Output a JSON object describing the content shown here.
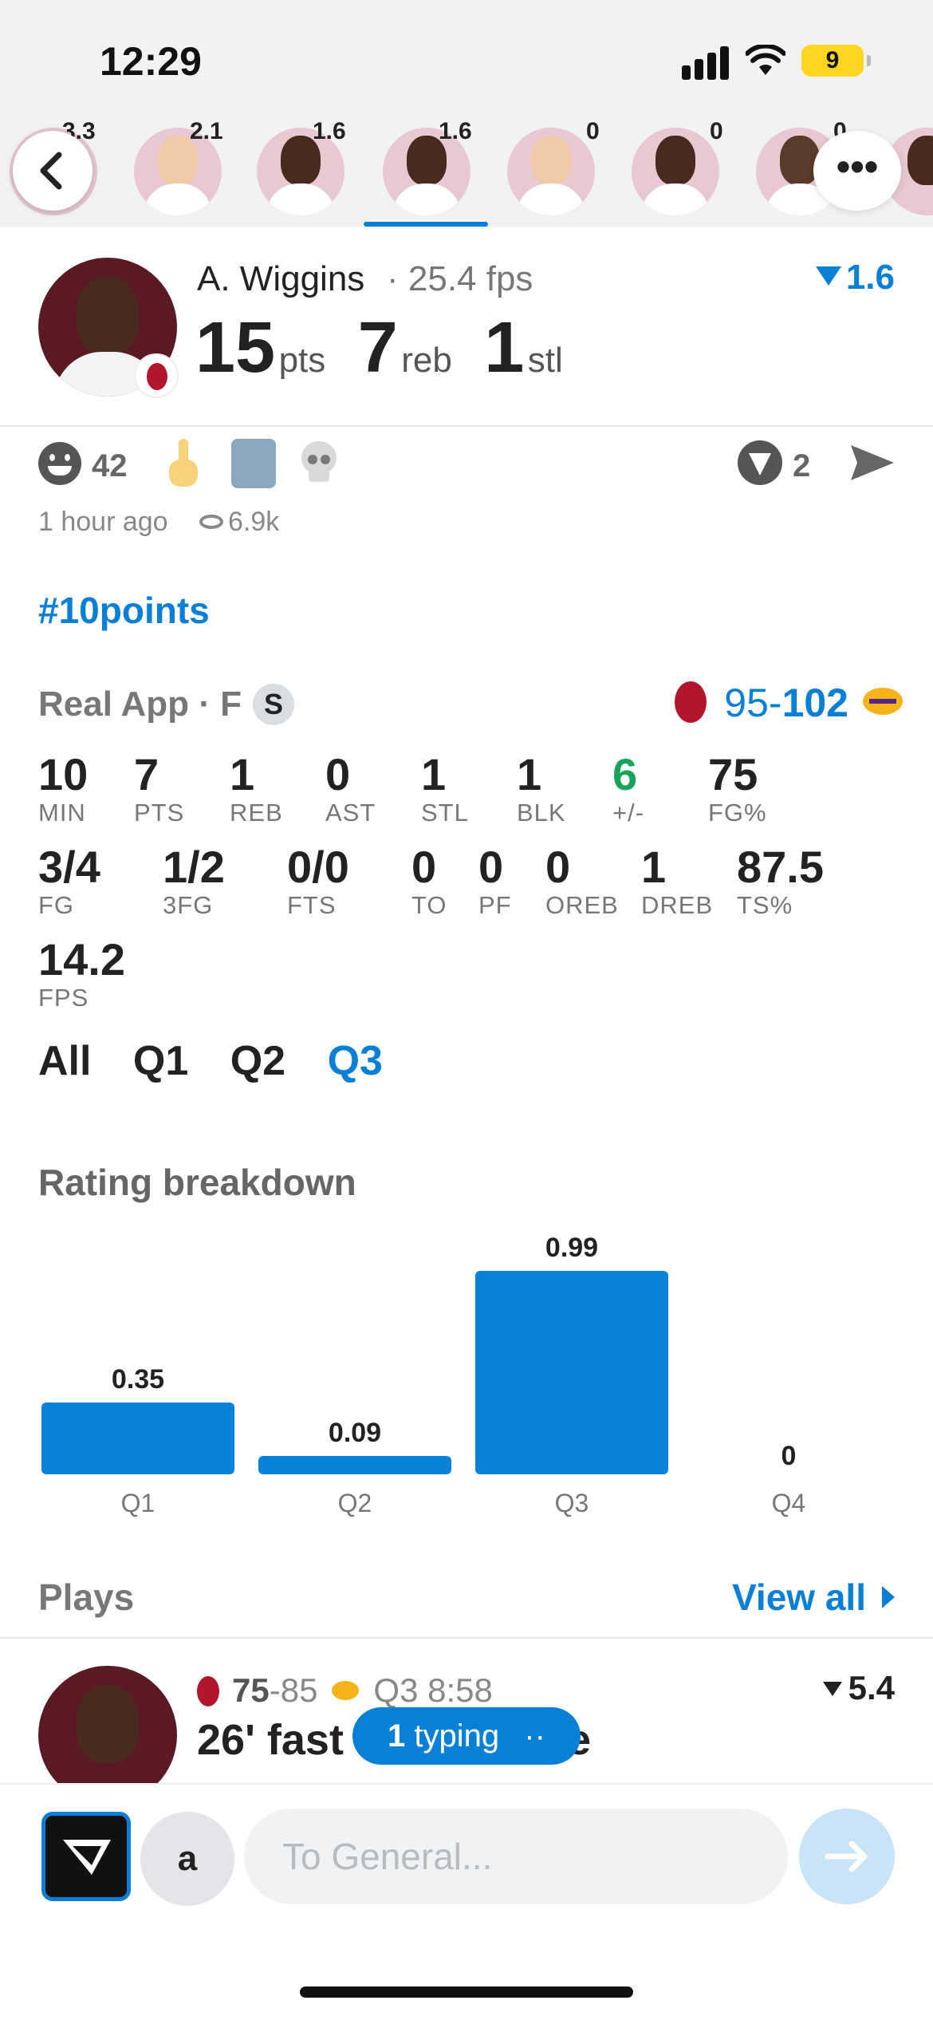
{
  "status_bar": {
    "time": "12:29",
    "battery": "9"
  },
  "carousel": {
    "players": [
      {
        "rating": "3.3",
        "active": false
      },
      {
        "rating": "2.1",
        "active": false
      },
      {
        "rating": "1.6",
        "active": false
      },
      {
        "rating": "1.6",
        "active": true
      },
      {
        "rating": "0",
        "active": false
      },
      {
        "rating": "0",
        "active": false
      },
      {
        "rating": "0",
        "active": false
      }
    ],
    "more_label": "•••"
  },
  "player": {
    "name": "A. Wiggins",
    "fps": "· 25.4 fps",
    "rating": "1.6",
    "stats": [
      {
        "value": "15",
        "label": "pts"
      },
      {
        "value": "7",
        "label": "reb"
      },
      {
        "value": "1",
        "label": "stl"
      }
    ]
  },
  "reactions": {
    "smile_count": "42",
    "boost_count": "2",
    "time_ago": "1 hour ago",
    "views": "6.9k"
  },
  "hashtag": "#10points",
  "game": {
    "source": "Real App · F",
    "badge": "S",
    "score_home": "95",
    "score_sep": "-",
    "score_away": "102",
    "stats_row1": [
      {
        "value": "10",
        "label": "MIN"
      },
      {
        "value": "7",
        "label": "PTS"
      },
      {
        "value": "1",
        "label": "REB"
      },
      {
        "value": "0",
        "label": "AST"
      },
      {
        "value": "1",
        "label": "STL"
      },
      {
        "value": "1",
        "label": "BLK"
      },
      {
        "value": "6",
        "label": "+/-"
      },
      {
        "value": "75",
        "label": "FG%"
      }
    ],
    "stats_row2": [
      {
        "value": "3/4",
        "label": "FG"
      },
      {
        "value": "1/2",
        "label": "3FG"
      },
      {
        "value": "0/0",
        "label": "FTS"
      },
      {
        "value": "0",
        "label": "TO"
      },
      {
        "value": "0",
        "label": "PF"
      },
      {
        "value": "0",
        "label": "OREB"
      },
      {
        "value": "1",
        "label": "DREB"
      },
      {
        "value": "87.5",
        "label": "TS%"
      }
    ],
    "stats_row3": [
      {
        "value": "14.2",
        "label": "FPS"
      }
    ],
    "quarter_tabs": [
      "All",
      "Q1",
      "Q2",
      "Q3"
    ],
    "active_tab": "Q3"
  },
  "rating_breakdown": {
    "title": "Rating breakdown"
  },
  "chart_data": {
    "type": "bar",
    "title": "Rating breakdown",
    "categories": [
      "Q1",
      "Q2",
      "Q3",
      "Q4"
    ],
    "values": [
      0.35,
      0.09,
      0.99,
      0
    ],
    "value_labels": [
      "0.35",
      "0.09",
      "0.99",
      "0"
    ],
    "color": "#0981d8",
    "ylim": [
      0,
      1
    ],
    "grid": false
  },
  "plays": {
    "title": "Plays",
    "view_all": "View all",
    "first_play": {
      "score_home": "75",
      "score_sep": "-85",
      "time": "Q3 8:58",
      "rating": "5.4",
      "description": "26' fast",
      "description_tail": "e"
    }
  },
  "typing": {
    "count": "1",
    "label": "typing",
    "dots": "··"
  },
  "composer": {
    "avatar_letter": "a",
    "placeholder": "To General..."
  },
  "colors": {
    "accent": "#0a7fd6",
    "positive": "#16a35a",
    "heat": "#b3152e",
    "lakers": "#f5b41a"
  }
}
